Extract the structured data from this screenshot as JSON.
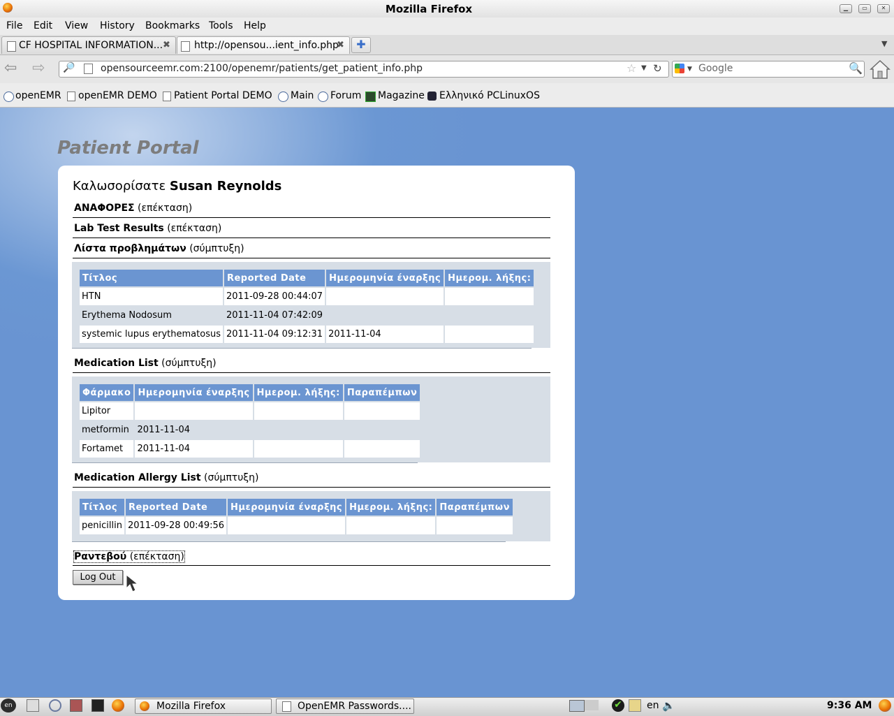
{
  "window": {
    "title": "Mozilla Firefox"
  },
  "menu": [
    "File",
    "Edit",
    "View",
    "History",
    "Bookmarks",
    "Tools",
    "Help"
  ],
  "tabs": [
    {
      "label": "CF HOSPITAL INFORMATION..."
    },
    {
      "label": "http://opensou...ient_info.php"
    }
  ],
  "nav": {
    "url": "opensourceemr.com:2100/openemr/patients/get_patient_info.php",
    "search_placeholder": "Google"
  },
  "bookmarks": [
    "openEMR",
    "openEMR DEMO",
    "Patient Portal DEMO",
    "Main",
    "Forum",
    "Magazine",
    "Ελληνικό PCLinuxOS"
  ],
  "portal": {
    "title": "Patient Portal",
    "welcome_prefix": "Καλωσορίσατε",
    "patient_name": "Susan Reynolds",
    "sections": {
      "reports": {
        "title": "ΑΝΑΦΟΡΕΣ",
        "toggle": "(επέκταση)"
      },
      "lab": {
        "title": "Lab Test Results",
        "toggle": "(επέκταση)"
      },
      "problems": {
        "title": "Λίστα προβλημάτων",
        "toggle": "(σύμπτυξη)"
      },
      "medications": {
        "title": "Medication List",
        "toggle": "(σύμπτυξη)"
      },
      "allergies": {
        "title": "Medication Allergy List",
        "toggle": "(σύμπτυξη)"
      },
      "appointments": {
        "title": "Ραντεβού",
        "toggle": "(επέκταση)"
      }
    },
    "problems_table": {
      "headers": [
        "Τίτλος",
        "Reported Date",
        "Ημερομηνία έναρξης",
        "Ημερομ. λήξης:"
      ],
      "rows": [
        [
          "HTN",
          "2011-09-28 00:44:07",
          "",
          ""
        ],
        [
          "Erythema Nodosum",
          "2011-11-04 07:42:09",
          "",
          ""
        ],
        [
          "systemic lupus erythematosus",
          "2011-11-04 09:12:31",
          "2011-11-04",
          ""
        ]
      ]
    },
    "medications_table": {
      "headers": [
        "Φάρμακο",
        "Ημερομηνία έναρξης",
        "Ημερομ. λήξης:",
        "Παραπέμπων"
      ],
      "rows": [
        [
          "Lipitor",
          "",
          "",
          ""
        ],
        [
          "metformin",
          "2011-11-04",
          "",
          ""
        ],
        [
          "Fortamet",
          "2011-11-04",
          "",
          ""
        ]
      ]
    },
    "allergies_table": {
      "headers": [
        "Τίτλος",
        "Reported Date",
        "Ημερομηνία έναρξης",
        "Ημερομ. λήξης:",
        "Παραπέμπων"
      ],
      "rows": [
        [
          "penicillin",
          "2011-09-28 00:49:56",
          "",
          "",
          ""
        ]
      ]
    },
    "logout_label": "Log Out"
  },
  "taskbar": {
    "windows": [
      "Mozilla Firefox",
      "OpenEMR Passwords...."
    ],
    "lang": "en",
    "clock": "9:36 AM"
  }
}
